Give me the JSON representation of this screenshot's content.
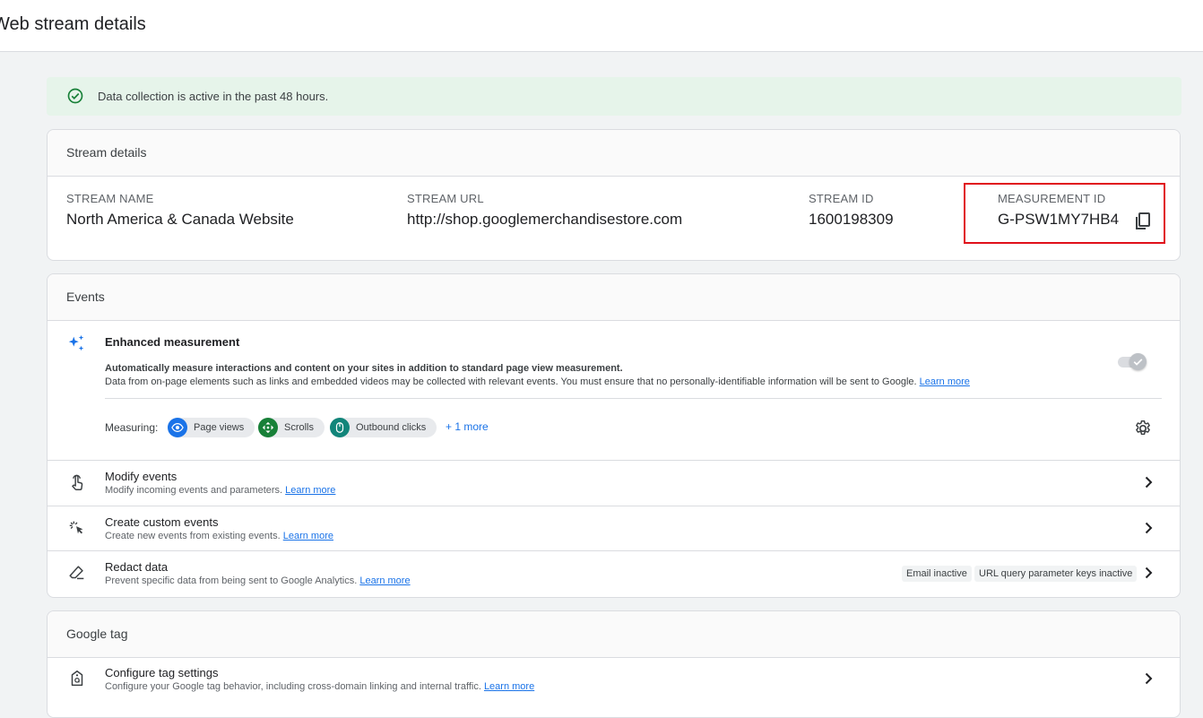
{
  "header": {
    "title": "Web stream details"
  },
  "banner": {
    "text": "Data collection is active in the past 48 hours."
  },
  "stream_details": {
    "title": "Stream details",
    "fields": [
      {
        "label": "STREAM NAME",
        "value": "North America & Canada Website"
      },
      {
        "label": "STREAM URL",
        "value": "http://shop.googlemerchandisestore.com"
      },
      {
        "label": "STREAM ID",
        "value": "1600198309"
      },
      {
        "label": "MEASUREMENT ID",
        "value": "G-PSW1MY7HB4"
      }
    ]
  },
  "events": {
    "title": "Events",
    "enhanced": {
      "title": "Enhanced measurement",
      "desc_bold": "Automatically measure interactions and content on your sites in addition to standard page view measurement.",
      "desc": "Data from on-page elements such as links and embedded videos may be collected with relevant events. You must ensure that no personally-identifiable information will be sent to Google.",
      "learn_more": "Learn more",
      "measuring_label": "Measuring:",
      "chips": [
        "Page views",
        "Scrolls",
        "Outbound clicks"
      ],
      "more": "+ 1 more"
    },
    "rows": [
      {
        "title": "Modify events",
        "subtitle": "Modify incoming events and parameters.",
        "link": "Learn more"
      },
      {
        "title": "Create custom events",
        "subtitle": "Create new events from existing events.",
        "link": "Learn more"
      },
      {
        "title": "Redact data",
        "subtitle": "Prevent specific data from being sent to Google Analytics.",
        "link": "Learn more",
        "badges": [
          "Email inactive",
          "URL query parameter keys inactive"
        ]
      }
    ]
  },
  "google_tag": {
    "title": "Google tag",
    "rows": [
      {
        "title": "Configure tag settings",
        "subtitle": "Configure your Google tag behavior, including cross-domain linking and internal traffic.",
        "link": "Learn more"
      }
    ]
  },
  "colors": {
    "accent": "#1a73e8",
    "success": "#188038",
    "highlight": "#e0101a",
    "chip_page_views": "#1a73e8",
    "chip_scrolls": "#188038",
    "chip_outbound": "#12857a"
  }
}
